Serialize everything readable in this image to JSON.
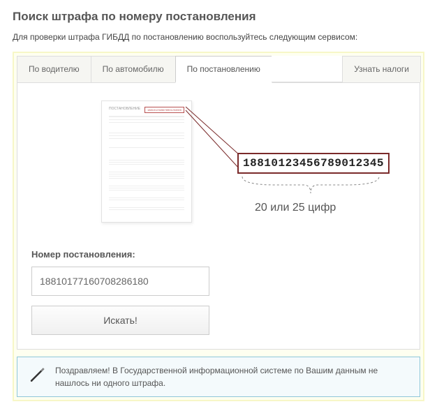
{
  "page": {
    "title": "Поиск штрафа по номеру постановления",
    "description": "Для проверки штрафа ГИБДД по постановлению воспользуйтесь следующим сервисом:"
  },
  "tabs": {
    "by_driver": "По водителю",
    "by_car": "По автомобилю",
    "by_decree": "По постановлению",
    "taxes": "Узнать налоги"
  },
  "diagram": {
    "doc_title": "ПОСТАНОВЛЕНИЕ",
    "doc_uin_small": "1881012345678901234500",
    "sample_uin": "18810123456789012345",
    "digits_hint": "20 или 25 цифр"
  },
  "form": {
    "field_label": "Номер постановления:",
    "uin_value": "18810177160708286180",
    "search_button": "Искать!"
  },
  "result": {
    "message": "Поздравляем! В Государственной информационной системе по Вашим данным не нашлось ни одного штрафа."
  }
}
